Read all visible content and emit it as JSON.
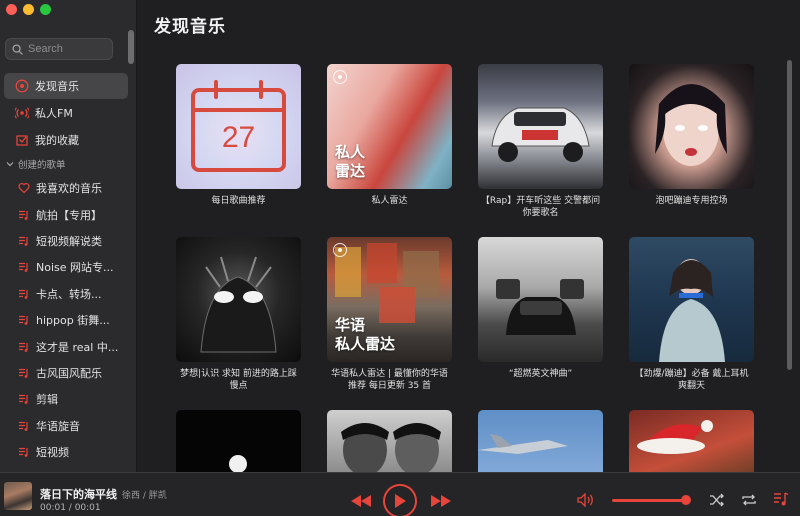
{
  "sidebar": {
    "search_placeholder": "Search",
    "nav": [
      {
        "label": "发现音乐",
        "icon": "discover-icon",
        "active": true
      },
      {
        "label": "私人FM",
        "icon": "radio-icon",
        "active": false
      },
      {
        "label": "我的收藏",
        "icon": "collection-icon",
        "active": false
      }
    ],
    "section_title": "创建的歌单",
    "playlists": [
      {
        "label": "我喜欢的音乐",
        "icon": "heart-icon"
      },
      {
        "label": "航拍【专用】",
        "icon": "playlist-icon"
      },
      {
        "label": "短视频解说类",
        "icon": "playlist-icon"
      },
      {
        "label": "Noise 网站专...",
        "icon": "playlist-icon"
      },
      {
        "label": "卡点、转场...",
        "icon": "playlist-icon"
      },
      {
        "label": "hippop 街舞...",
        "icon": "playlist-icon"
      },
      {
        "label": "这才是 real 中...",
        "icon": "playlist-icon"
      },
      {
        "label": "古风国风配乐",
        "icon": "playlist-icon"
      },
      {
        "label": "剪辑",
        "icon": "playlist-icon"
      },
      {
        "label": "华语旋音",
        "icon": "playlist-icon"
      },
      {
        "label": "短视频",
        "icon": "playlist-icon"
      }
    ]
  },
  "main": {
    "title": "发现音乐",
    "cards": [
      {
        "caption": "每日歌曲推荐",
        "calendar_day": "27"
      },
      {
        "caption": "私人雷达",
        "cover_text_1": "私人",
        "cover_text_2": "雷达"
      },
      {
        "caption": "【Rap】开车听这些 交警都问你要歌名"
      },
      {
        "caption": "泡吧蹦迪专用控场"
      },
      {
        "caption": "梦想|认识 求知 前进的路上踩慢点"
      },
      {
        "caption": "华语私人雷达 | 最懂你的华语推荐 每日更新 35 首",
        "cover_text_1": "华语",
        "cover_text_2": "私人雷达"
      },
      {
        "caption": "“超燃英文神曲”"
      },
      {
        "caption": "【劲爆/蹦迪】必备 戴上耳机爽翻天"
      },
      {
        "caption": ""
      },
      {
        "caption": ""
      },
      {
        "caption": ""
      },
      {
        "caption": ""
      }
    ]
  },
  "player": {
    "title": "落日下的海平线",
    "artist": "徐西 / 胖凯",
    "time": "00:01 / 00:01",
    "volume_fraction": 0.95,
    "accent": "#e6453b"
  }
}
